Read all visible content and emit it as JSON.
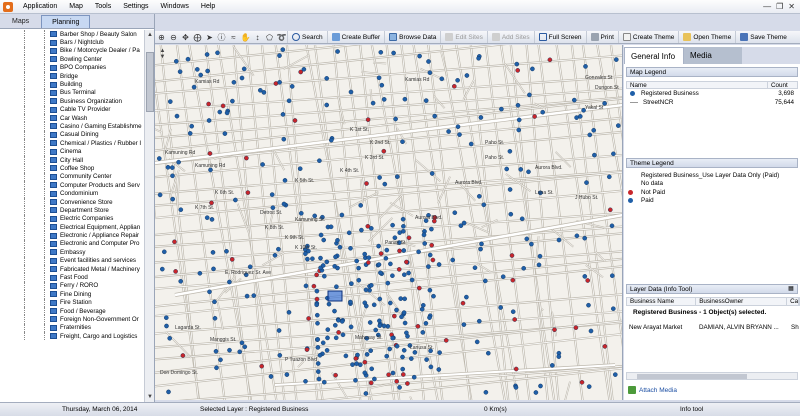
{
  "menu": [
    "Application",
    "Map",
    "Tools",
    "Settings",
    "Windows",
    "Help"
  ],
  "left_tabs": [
    "Maps",
    "Planning"
  ],
  "layers": [
    "Barber Shop / Beauty Salon",
    "Bars / Nightclub",
    "Bike / Motorcycle Dealer / Pa",
    "Bowling Center",
    "BPO Companies",
    "Bridge",
    "Building",
    "Bus Terminal",
    "Business Organization",
    "Cable TV Provider",
    "Car Wash",
    "Casino / Gaming Establishme",
    "Casual Dining",
    "Chemical / Plastics / Rubber I",
    "Cinema",
    "City Hall",
    "Coffee Shop",
    "Community Center",
    "Computer Products and Serv",
    "Condominium",
    "Convenience Store",
    "Department Store",
    "Electric Companies",
    "Electrical Equipment, Applian",
    "Electronic / Appliance Repair",
    "Electronic and Computer Pro",
    "Embassy",
    "Event facilities and services",
    "Fabricated Metal / Machinery",
    "Fast Food",
    "Ferry / RORO",
    "Fine Dining",
    "Fire Station",
    "Food / Beverage",
    "Foreign Non-Government Or",
    "Fraternities",
    "Freight, Cargo and Logistics"
  ],
  "toolbar": {
    "search": "Search",
    "create_buffer": "Create Buffer",
    "browse_data": "Browse Data",
    "edit_sites": "Edit Sites",
    "add_sites": "Add Sites",
    "full_screen": "Full Screen",
    "print": "Print",
    "create_theme": "Create Theme",
    "open_theme": "Open Theme",
    "save_theme": "Save Theme"
  },
  "map_labels": [
    "Kamias Rd",
    "Kamias Rd",
    "K 1st St.",
    "K 2nd St.",
    "K 3rd St.",
    "K 4th St.",
    "K 5th St.",
    "K 6th St.",
    "K 7th St.",
    "K 8th St.",
    "K 9th St.",
    "K 10th St.",
    "Kamuning Rd",
    "Kamuning Rd",
    "Paho St.",
    "Paho St.",
    "Aurora Blvd.",
    "Aurora Blvd.",
    "Aurora Blvd.",
    "E. Rodriguez Sr. Ave",
    "Lagarda St.",
    "Luna St.",
    "J Hubo St.",
    "Gonzales St",
    "Dungon St",
    "Yakal St",
    "Manggis St.",
    "P Tuazon Blvd",
    "Detroit St.",
    "Kamuning St.",
    "Don Domingo St.",
    "Panay St.",
    "Mahusay St.",
    "Lanusa St."
  ],
  "right_panel": {
    "tabs": [
      "General Info",
      "Media"
    ],
    "map_legend_title": "Map Legend",
    "legend_columns": [
      "Name",
      "Count"
    ],
    "legend_rows": [
      {
        "name": "Registered Business",
        "count": "3,698",
        "color": "#1f5fa8"
      },
      {
        "name": "StreetNCR",
        "count": "75,644",
        "color": "#999999"
      }
    ],
    "theme_legend_title": "Theme Legend",
    "theme_rows": [
      {
        "label": "Registered Business_Use Layer Data Only (Paid)",
        "color": ""
      },
      {
        "label": "No data",
        "color": ""
      },
      {
        "label": "Not Paid",
        "color": "#c8262b"
      },
      {
        "label": "Paid",
        "color": "#1f5fa8"
      }
    ],
    "layer_data_title": "Layer Data (Info Tool)",
    "grid_columns": [
      "Business Name",
      "BusinessOwner",
      "Ca"
    ],
    "grid_message": "Registered Business - 1 Object(s) selected.",
    "grid_row": [
      "New Arayat Market",
      "DAMIAN, ALVIN BRYANN ...",
      "Sh"
    ],
    "attach_media": "Attach Media"
  },
  "status": {
    "date": "Thursday, March 06, 2014",
    "selected_layer": "Selected Layer : Registered Business",
    "distance": "0 Km(s)",
    "tool": "Info tool"
  },
  "colors": {
    "paid": "#1f5fa8",
    "not_paid": "#c8262b",
    "road": "#ffffff",
    "road_edge": "#bdb8ad",
    "map_bg": "#f3f1ec"
  }
}
